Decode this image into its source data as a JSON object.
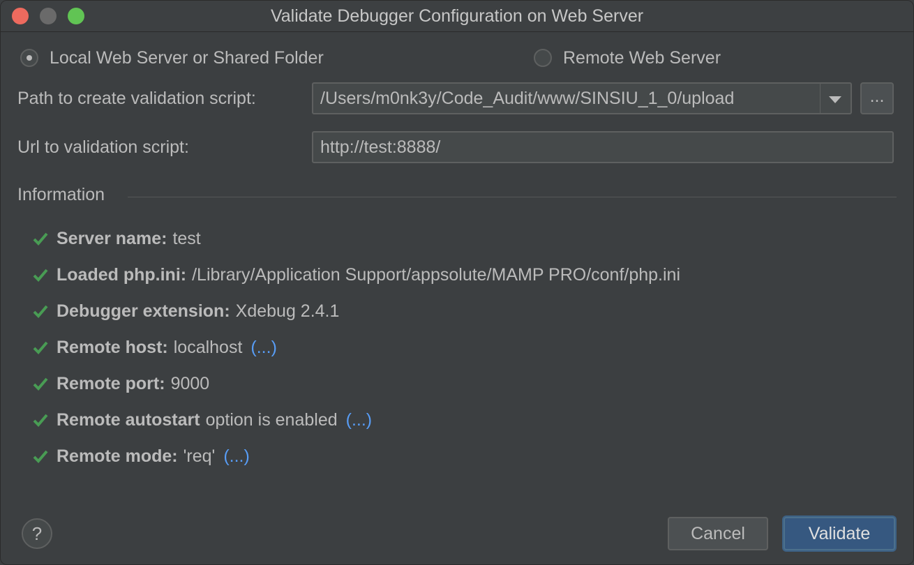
{
  "window": {
    "title": "Validate Debugger Configuration on Web Server"
  },
  "mode": {
    "local_label": "Local Web Server or Shared Folder",
    "remote_label": "Remote Web Server",
    "selected": "local"
  },
  "path": {
    "label": "Path to create validation script:",
    "value": "/Users/m0nk3y/Code_Audit/www/SINSIU_1_0/upload",
    "browse_label": "..."
  },
  "url": {
    "label": "Url to validation script:",
    "value": "http://test:8888/"
  },
  "info": {
    "title": "Information",
    "items": [
      {
        "key": "Server name:",
        "value": "test",
        "link": ""
      },
      {
        "key": "Loaded php.ini:",
        "value": "/Library/Application Support/appsolute/MAMP PRO/conf/php.ini",
        "link": ""
      },
      {
        "key": "Debugger extension:",
        "value": "Xdebug 2.4.1",
        "link": ""
      },
      {
        "key": "Remote host:",
        "value": "localhost",
        "link": "(...)"
      },
      {
        "key": "Remote port:",
        "value": "9000",
        "link": ""
      },
      {
        "key": "Remote autostart",
        "value": "option is enabled",
        "link": "(...)"
      },
      {
        "key": "Remote mode:",
        "value": "'req'",
        "link": "(...)"
      }
    ]
  },
  "footer": {
    "help_label": "?",
    "cancel_label": "Cancel",
    "validate_label": "Validate"
  },
  "colors": {
    "background": "#3c3f41",
    "check": "#499c54",
    "link": "#589df6",
    "primary_button": "#365880"
  }
}
